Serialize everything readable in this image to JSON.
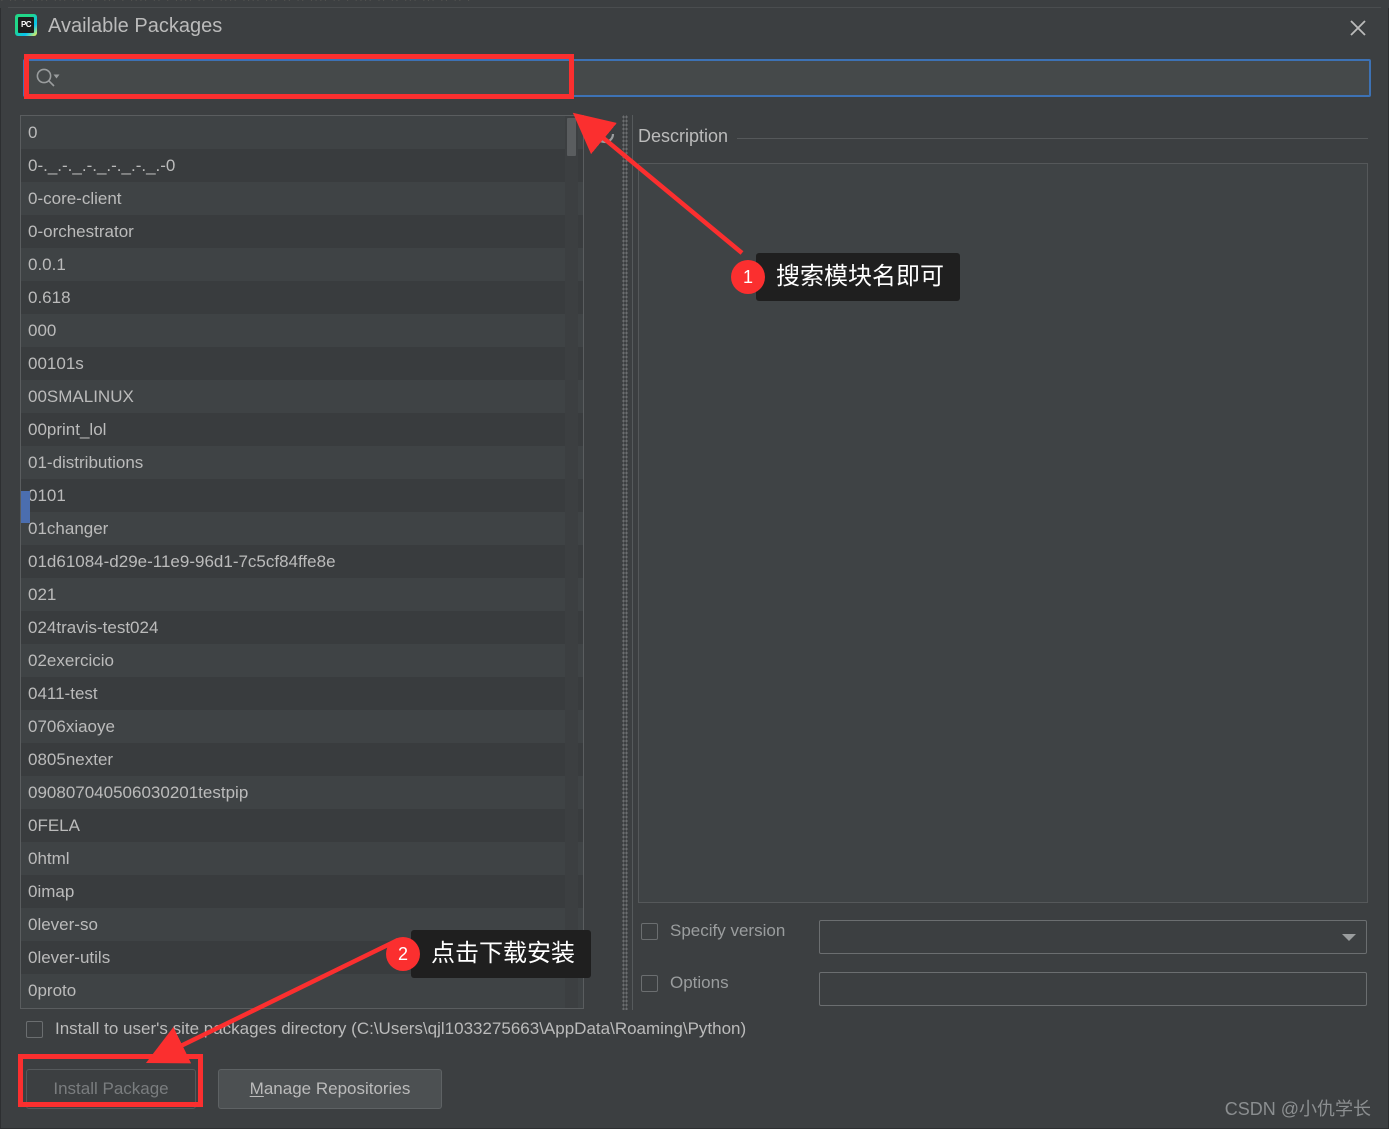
{
  "window": {
    "title": "Available Packages",
    "app_icon": "pycharm-icon",
    "app_icon_text": "PC",
    "close_icon": "close-icon"
  },
  "background_strip": {
    "text": "·  ·· ·   ···· ··· ···  ·· ··· ·  ···· ·· ·  ···· ·· ·  ···· ···· ··· ·· ·· ···· ·· ·  ···· ·· ··   ··· ···  ·· ·· ·"
  },
  "search": {
    "icon": "search-icon",
    "dropdown_icon": "chevron-down-icon",
    "value": "",
    "placeholder": ""
  },
  "package_list": {
    "items": [
      "0",
      "0-._.-._.-._.-._.-._.-0",
      "0-core-client",
      "0-orchestrator",
      "0.0.1",
      "0.618",
      "000",
      "00101s",
      "00SMALINUX",
      "00print_lol",
      "01-distributions",
      "0101",
      "01changer",
      "01d61084-d29e-11e9-96d1-7c5cf84ffe8e",
      "021",
      "024travis-test024",
      "02exercicio",
      "0411-test",
      "0706xiaoye",
      "0805nexter",
      "090807040506030201testpip",
      "0FELA",
      "0html",
      "0imap",
      "0lever-so",
      "0lever-utils",
      "0proto"
    ],
    "reload_icon": "reload-icon",
    "scrollbar": "vertical-scrollbar"
  },
  "description": {
    "label": "Description",
    "content": ""
  },
  "version_control": {
    "checkbox_label": "Specify version",
    "checked": false,
    "selected_value": "",
    "dropdown_icon": "chevron-down-icon"
  },
  "options_control": {
    "checkbox_label": "Options",
    "checked": false,
    "value": "",
    "placeholder": ""
  },
  "user_dir": {
    "label": "Install to user's site packages directory (C:\\Users\\qjl1033275663\\AppData\\Roaming\\Python)",
    "checked": false
  },
  "buttons": {
    "install": {
      "label": "Install Package",
      "enabled": false
    },
    "manage": {
      "label": "Manage Repositories",
      "mnemonic": "M",
      "enabled": true
    }
  },
  "annotations": [
    {
      "badge": "1",
      "text": "搜索模块名即可"
    },
    {
      "badge": "2",
      "text": "点击下载安装"
    }
  ],
  "watermark": "CSDN @小仇学长",
  "colors": {
    "accent_red": "#fb2f2f",
    "focus_blue": "#3d72b5",
    "selection_blue": "#4b6eaf",
    "dialog_bg": "#3c3f41",
    "row_odd": "#3f4345",
    "row_even": "#393c3e",
    "text": "#bbbbbb"
  }
}
